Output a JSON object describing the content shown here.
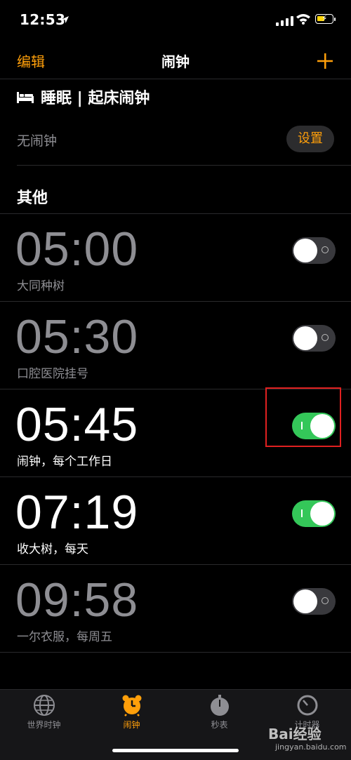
{
  "status_bar": {
    "time": "12:53"
  },
  "nav": {
    "edit": "编辑",
    "title": "闹钟",
    "add": "+"
  },
  "sleep": {
    "title": "睡眠 | 起床闹钟",
    "status": "无闹钟",
    "setup_button": "设置"
  },
  "others_heading": "其他",
  "alarms": [
    {
      "time": "05:00",
      "label": "大同种树",
      "enabled": false
    },
    {
      "time": "05:30",
      "label": "口腔医院挂号",
      "enabled": false
    },
    {
      "time": "05:45",
      "label": "闹钟，每个工作日",
      "enabled": true
    },
    {
      "time": "07:19",
      "label": "收大树，每天",
      "enabled": true
    },
    {
      "time": "09:58",
      "label": "一尔衣服，每周五",
      "enabled": false
    }
  ],
  "tabs": [
    {
      "label": "世界时钟",
      "icon": "globe-icon",
      "active": false
    },
    {
      "label": "闹钟",
      "icon": "alarm-clock-icon",
      "active": true
    },
    {
      "label": "秒表",
      "icon": "stopwatch-icon",
      "active": false
    },
    {
      "label": "计时器",
      "icon": "timer-icon",
      "active": false
    }
  ],
  "watermark": {
    "text": "Bai经验",
    "sub": "jingyan.baidu.com"
  },
  "colors": {
    "accent": "#ff9f0a",
    "toggle_on": "#34c759",
    "highlight": "#e02020"
  }
}
